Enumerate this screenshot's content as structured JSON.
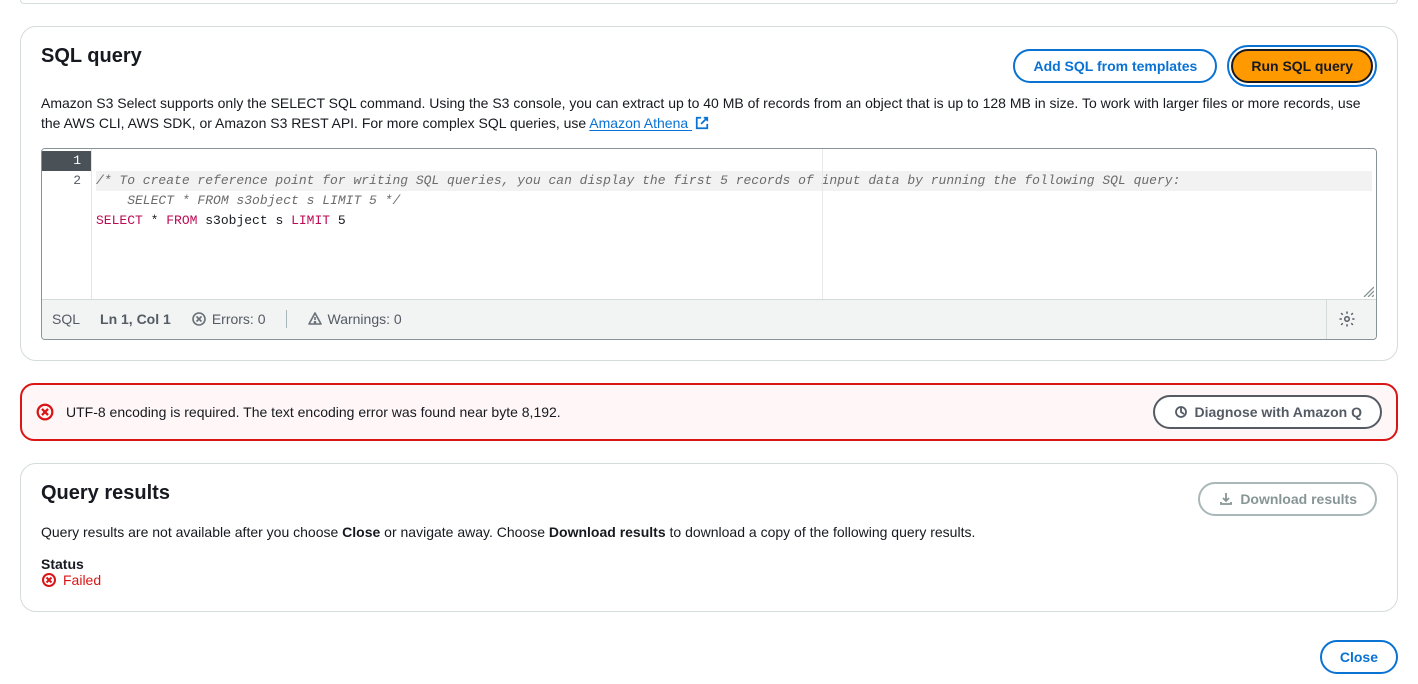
{
  "sqlPanel": {
    "title": "SQL query",
    "addTemplatesLabel": "Add SQL from templates",
    "runLabel": "Run SQL query",
    "desc1": "Amazon S3 Select supports only the SELECT SQL command. Using the S3 console, you can extract up to 40 MB of records from an object that is up to 128 MB in size. To work with larger files or more records, use the AWS CLI, AWS SDK, or Amazon S3 REST API. For more complex SQL queries, use ",
    "athenaLink": "Amazon Athena",
    "editor": {
      "gutter": [
        "1",
        "2"
      ],
      "line1_comment": "/* To create reference point for writing SQL queries, you can display the first 5 records of input data by running the following SQL query:",
      "line1b_comment": "    SELECT * FROM s3object s LIMIT 5 */",
      "line2_kw1": "SELECT",
      "line2_star": " * ",
      "line2_kw2": "FROM",
      "line2_obj": " s3object s ",
      "line2_kw3": "LIMIT",
      "line2_num": " 5"
    },
    "status": {
      "lang": "SQL",
      "cursor": "Ln 1, Col 1",
      "errors": "Errors: 0",
      "warnings": "Warnings: 0"
    }
  },
  "alert": {
    "message": "UTF-8 encoding is required. The text encoding error was found near byte 8,192.",
    "diagnoseLabel": "Diagnose with Amazon Q"
  },
  "results": {
    "title": "Query results",
    "downloadLabel": "Download results",
    "desc_pre": "Query results are not available after you choose ",
    "desc_close": "Close",
    "desc_mid": " or navigate away. Choose ",
    "desc_download": "Download results",
    "desc_post": " to download a copy of the following query results.",
    "statusLabel": "Status",
    "statusValue": "Failed"
  },
  "footer": {
    "closeLabel": "Close"
  }
}
